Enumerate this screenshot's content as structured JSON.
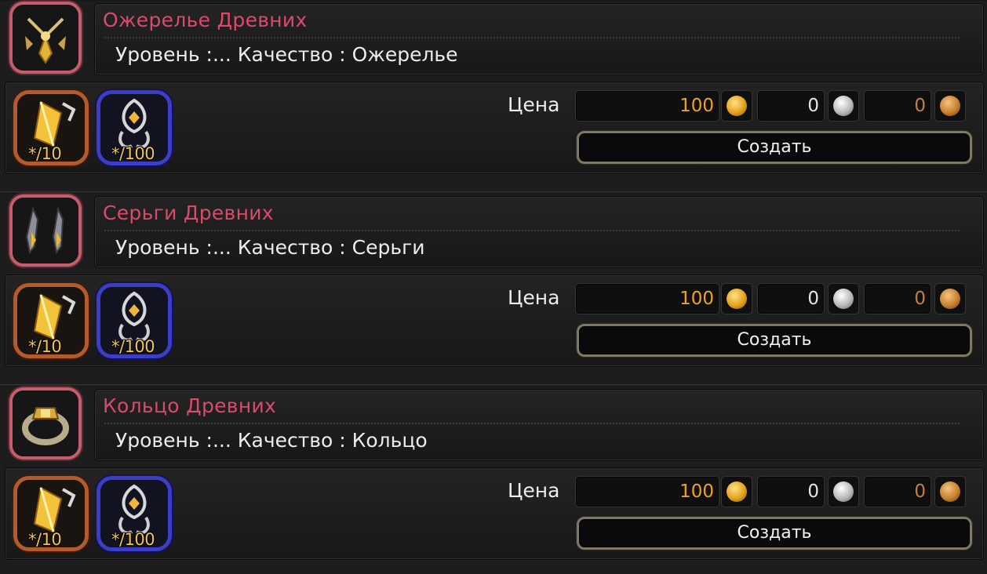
{
  "recipes": [
    {
      "name": "Ожерелье Древних",
      "info": "Уровень :... Качество : Ожерелье",
      "icon": "necklace-icon",
      "materials": [
        {
          "icon": "gold-crystal-icon",
          "count": "*/10"
        },
        {
          "icon": "silver-ornament-icon",
          "count": "*/100"
        }
      ],
      "price_label": "Цена",
      "price": {
        "gold": "100",
        "silver": "0",
        "bronze": "0"
      },
      "create_label": "Создать"
    },
    {
      "name": "Серьги Древних",
      "info": "Уровень :... Качество : Серьги",
      "icon": "earrings-icon",
      "materials": [
        {
          "icon": "gold-crystal-icon",
          "count": "*/10"
        },
        {
          "icon": "silver-ornament-icon",
          "count": "*/100"
        }
      ],
      "price_label": "Цена",
      "price": {
        "gold": "100",
        "silver": "0",
        "bronze": "0"
      },
      "create_label": "Создать"
    },
    {
      "name": "Кольцо Древних",
      "info": "Уровень :... Качество : Кольцо",
      "icon": "ring-icon",
      "materials": [
        {
          "icon": "gold-crystal-icon",
          "count": "*/10"
        },
        {
          "icon": "silver-ornament-icon",
          "count": "*/100"
        }
      ],
      "price_label": "Цена",
      "price": {
        "gold": "100",
        "silver": "0",
        "bronze": "0"
      },
      "create_label": "Создать"
    }
  ],
  "colors": {
    "item_name": "#d94a6b",
    "gold_value": "#f0a21c",
    "zero_value": "#e6e6e6",
    "zero_bronze": "#c2813a",
    "gold_frame": "#b35b2d",
    "blue_frame": "#3d3ec6",
    "item_frame": "#c45d6c"
  }
}
